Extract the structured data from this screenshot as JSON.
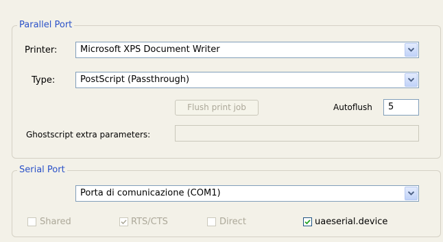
{
  "parallel_port": {
    "title": "Parallel Port",
    "printer_label": "Printer:",
    "printer_value": "Microsoft XPS Document Writer",
    "type_label": "Type:",
    "type_value": "PostScript (Passthrough)",
    "flush_label": "Flush print job",
    "autoflush_label": "Autoflush",
    "autoflush_value": "5",
    "ghostscript_label": "Ghostscript extra parameters:",
    "ghostscript_value": ""
  },
  "serial_port": {
    "title": "Serial Port",
    "port_value": "Porta di comunicazione (COM1)",
    "shared_label": "Shared",
    "shared_checked": false,
    "rtscts_label": "RTS/CTS",
    "rtscts_checked": true,
    "direct_label": "Direct",
    "direct_checked": false,
    "uaeserial_label": "uaeserial.device",
    "uaeserial_checked": true
  },
  "icons": {
    "dropdown": "chevron-down-icon",
    "check": "checkmark-icon"
  },
  "colors": {
    "group_title": "#2a51c8",
    "disabled_text": "#aca899",
    "input_border": "#7f9db9"
  }
}
